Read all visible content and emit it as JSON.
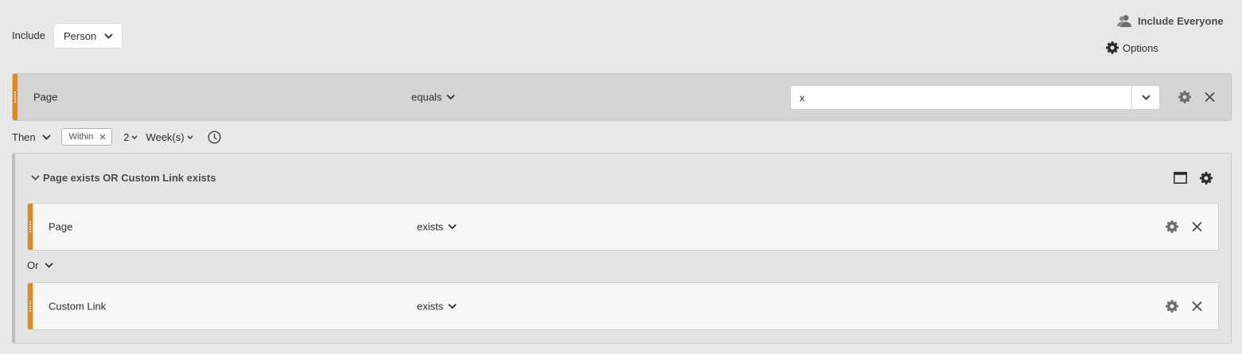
{
  "header": {
    "include_label": "Include",
    "include_select": "Person",
    "include_everyone": "Include Everyone",
    "options": "Options"
  },
  "main_rule": {
    "dimension": "Page",
    "operator": "equals",
    "value": "x"
  },
  "then_row": {
    "label": "Then",
    "within_chip": "Within",
    "number": "2",
    "unit": "Week(s)"
  },
  "container": {
    "title": "Page exists OR Custom Link exists",
    "rules": [
      {
        "dimension": "Page",
        "operator": "exists"
      },
      {
        "dimension": "Custom Link",
        "operator": "exists"
      }
    ],
    "or_label": "Or"
  },
  "colors": {
    "accent_grip": "#e68619",
    "background": "#e8e8e8",
    "main_rule_bg": "#d5d5d5",
    "sub_rule_bg": "#f7f7f7"
  }
}
